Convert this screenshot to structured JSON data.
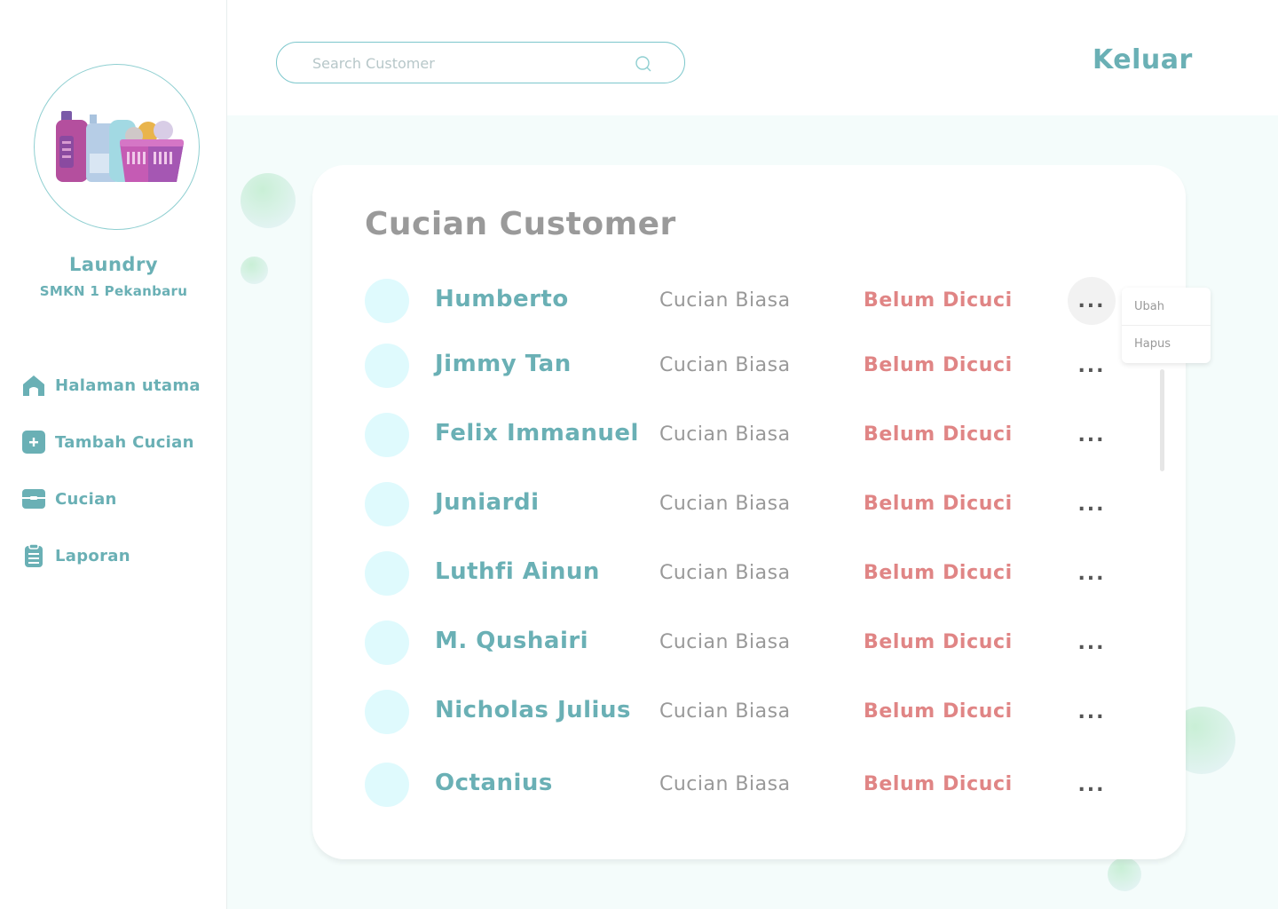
{
  "sidebar": {
    "logo_icon": "laundry-basket-illustration",
    "brand_title": "Laundry",
    "brand_subtitle": "SMKN 1 Pekanbaru",
    "items": [
      {
        "label": "Halaman utama",
        "icon": "home-icon"
      },
      {
        "label": "Tambah Cucian",
        "icon": "plus-square-icon"
      },
      {
        "label": "Cucian",
        "icon": "basket-icon"
      },
      {
        "label": "Laporan",
        "icon": "clipboard-icon"
      }
    ]
  },
  "header": {
    "search_placeholder": "Search Customer",
    "logout_label": "Keluar"
  },
  "main": {
    "title": "Cucian Customer",
    "rows": [
      {
        "name": "Humberto",
        "type": "Cucian Biasa",
        "status": "Belum Dicuci",
        "more": "..."
      },
      {
        "name": "Jimmy Tan",
        "type": "Cucian Biasa",
        "status": "Belum Dicuci",
        "more": "..."
      },
      {
        "name": "Felix Immanuel",
        "type": "Cucian Biasa",
        "status": "Belum Dicuci",
        "more": "..."
      },
      {
        "name": "Juniardi",
        "type": "Cucian Biasa",
        "status": "Belum Dicuci",
        "more": "..."
      },
      {
        "name": "Luthfi Ainun",
        "type": "Cucian Biasa",
        "status": "Belum Dicuci",
        "more": "..."
      },
      {
        "name": "M. Qushairi",
        "type": "Cucian Biasa",
        "status": "Belum Dicuci",
        "more": "..."
      },
      {
        "name": "Nicholas Julius",
        "type": "Cucian Biasa",
        "status": "Belum Dicuci",
        "more": "..."
      },
      {
        "name": "Octanius",
        "type": "Cucian Biasa",
        "status": "Belum Dicuci",
        "more": "..."
      }
    ]
  },
  "context_menu": {
    "edit_label": "Ubah",
    "delete_label": "Hapus"
  },
  "colors": {
    "accent": "#6ab0b5",
    "status_pending": "#e08585",
    "muted_text": "#999999",
    "avatar_bg": "#dffafd",
    "main_bg": "#f4fcfb"
  }
}
